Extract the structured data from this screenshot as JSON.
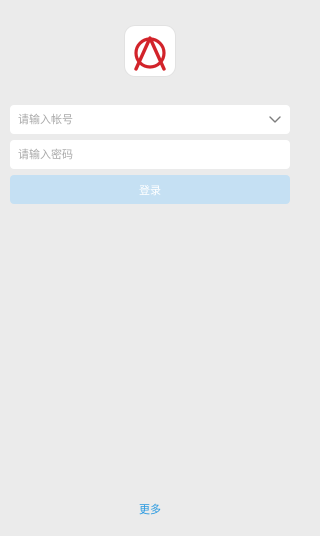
{
  "logo": {
    "icon": "app-logo-icon",
    "color": "#d2232a"
  },
  "login_form": {
    "account_placeholder": "请输入帐号",
    "account_value": "",
    "account_dropdown_icon": "chevron-down-icon",
    "password_placeholder": "请输入密码",
    "password_value": "",
    "login_label": "登录",
    "login_button_color": "#c5e0f3"
  },
  "footer": {
    "more_label": "更多",
    "link_color": "#2b9ae0"
  }
}
